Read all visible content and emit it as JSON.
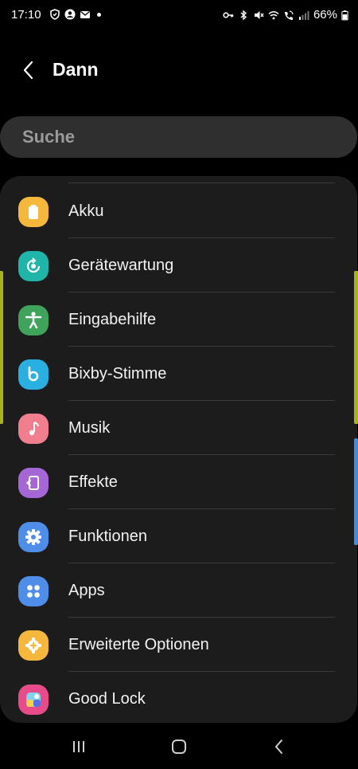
{
  "status_bar": {
    "time": "17:10",
    "battery": "66%",
    "left_icons": [
      "shield-icon",
      "account-icon",
      "mail-icon",
      "dot-icon"
    ],
    "right_icons": [
      "key-icon",
      "bluetooth-icon",
      "mute-icon",
      "wifi-icon",
      "wifi-call-icon",
      "signal-icon",
      "battery-icon"
    ]
  },
  "header": {
    "title": "Dann"
  },
  "search": {
    "placeholder": "Suche"
  },
  "list": {
    "items": [
      {
        "label": "Akku",
        "icon": "battery-icon",
        "color": "#f5b73c"
      },
      {
        "label": "Gerätewartung",
        "icon": "device-care-icon",
        "color": "#1fb5a8"
      },
      {
        "label": "Eingabehilfe",
        "icon": "accessibility-icon",
        "color": "#3fa35b"
      },
      {
        "label": "Bixby-Stimme",
        "icon": "bixby-icon",
        "color": "#2ab0e0"
      },
      {
        "label": "Musik",
        "icon": "music-icon",
        "color": "#f07e8d"
      },
      {
        "label": "Effekte",
        "icon": "effects-icon",
        "color": "#a566d6"
      },
      {
        "label": "Funktionen",
        "icon": "gear-icon",
        "color": "#4f8ee8"
      },
      {
        "label": "Apps",
        "icon": "apps-icon",
        "color": "#4f8ee8"
      },
      {
        "label": "Erweiterte Optionen",
        "icon": "advanced-gear-icon",
        "color": "#f5b73c"
      },
      {
        "label": "Good Lock",
        "icon": "good-lock-icon",
        "color": "#e84b8a"
      }
    ]
  },
  "colors": {
    "accent_edge": "#a6b41a",
    "scrollbar": "#3b8ee0",
    "card_bg": "#1c1c1c",
    "search_bg": "#2f2f2f"
  },
  "navbar": {
    "buttons": [
      "recents-icon",
      "home-icon",
      "back-icon"
    ]
  }
}
